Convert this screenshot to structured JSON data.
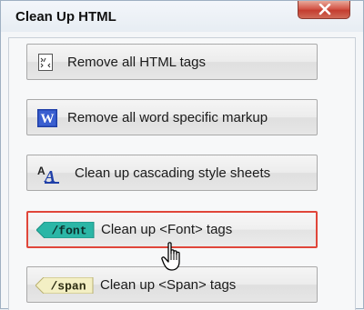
{
  "dialog": {
    "title": "Clean Up HTML",
    "close_icon": "close-icon"
  },
  "buttons": [
    {
      "label": "Remove all HTML tags",
      "icon": "html-tags-icon"
    },
    {
      "label": "Remove all word specific markup",
      "icon": "word-icon"
    },
    {
      "label": "Clean up cascading style sheets",
      "icon": "css-style-icon"
    },
    {
      "label": "Clean up <Font> tags",
      "icon": "font-tag-icon",
      "icon_text": "/font",
      "state": "hover"
    },
    {
      "label": "Clean up <Span> tags",
      "icon": "span-tag-icon",
      "icon_text": "/span"
    }
  ],
  "colors": {
    "hover_border": "#e0463a",
    "font_tag": "#2bb6a6",
    "span_tag": "#f3efc4",
    "word_blue": "#1f3fa8"
  }
}
